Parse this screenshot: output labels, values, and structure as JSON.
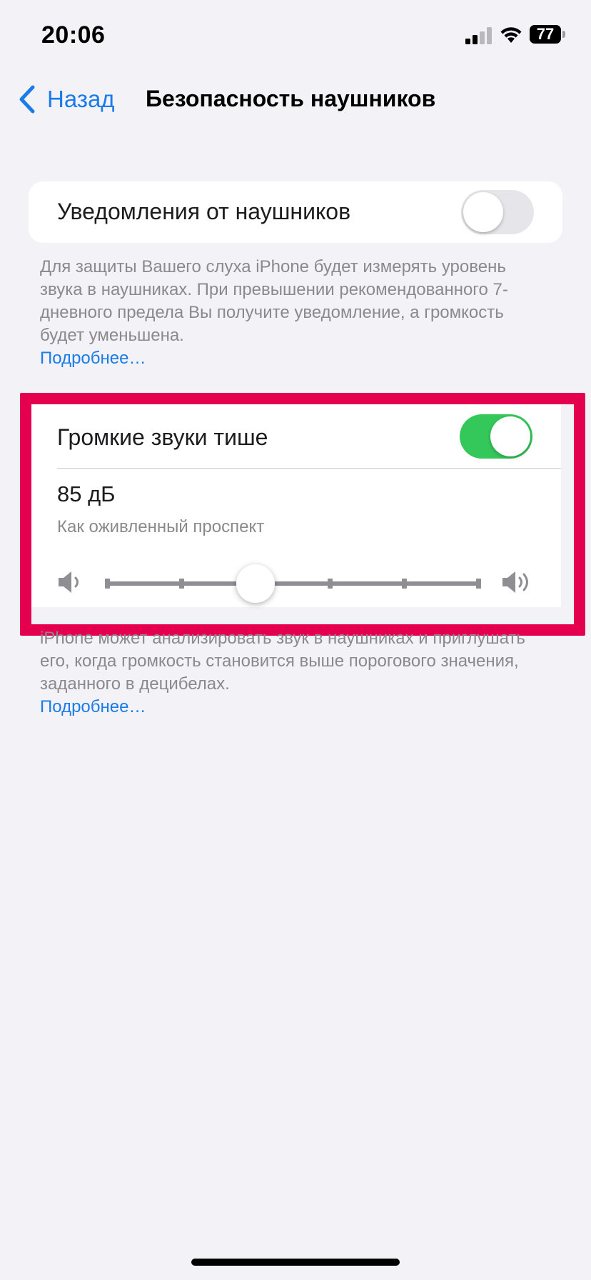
{
  "status_bar": {
    "time": "20:06",
    "battery_percent": "77",
    "signal_bars_active": 2,
    "signal_bars_total": 4
  },
  "nav": {
    "back_label": "Назад",
    "title": "Безопасность наушников"
  },
  "headphone_notifications": {
    "label": "Уведомления от наушников",
    "enabled": false,
    "footnote": "Для защиты Вашего слуха iPhone будет измерять уровень звука в наушниках. При превышении рекомендованного 7-дневного предела Вы получите уведомление, а громкость будет уменьшена.",
    "more_link": "Подробнее…"
  },
  "reduce_loud_audio": {
    "label": "Громкие звуки тише",
    "enabled": true,
    "level_value": "85 дБ",
    "level_description": "Как оживленный проспект",
    "slider_steps": 6,
    "slider_selected_index": 2,
    "footnote": "iPhone может анализировать звук в наушниках и приглушать его, когда громкость становится выше порогового значения, заданного в децибелах.",
    "more_link": "Подробнее…"
  },
  "colors": {
    "accent": "#1a7ce8",
    "toggle_on": "#34c759",
    "highlight": "#e4004f",
    "background": "#f2f2f7"
  },
  "icons": {
    "back": "chevron-left-icon",
    "volume_low": "speaker-low-icon",
    "volume_high": "speaker-high-icon"
  }
}
